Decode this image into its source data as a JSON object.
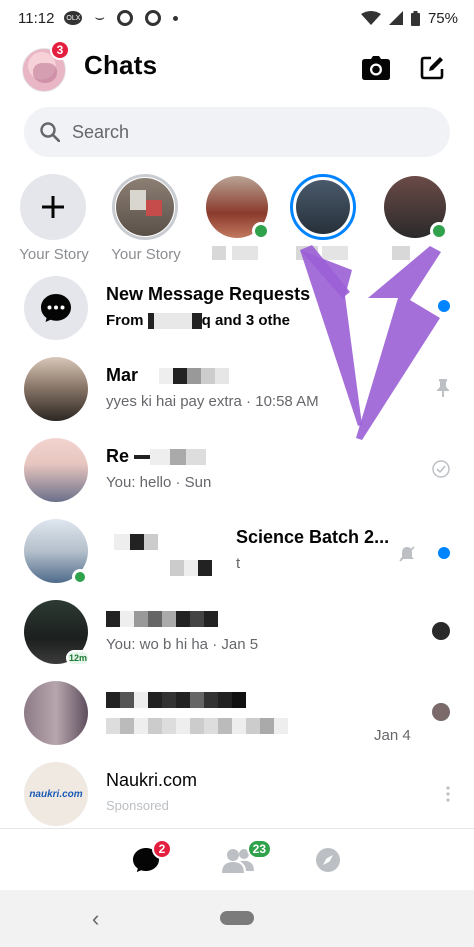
{
  "status_bar": {
    "time": "11:12",
    "battery": "75%",
    "left_icon_oval": "OLX"
  },
  "header": {
    "title": "Chats",
    "avatar_badge": "3"
  },
  "search": {
    "placeholder": "Search"
  },
  "stories": [
    {
      "label": "Your Story",
      "type": "add"
    },
    {
      "label": "Your Story",
      "type": "own"
    }
  ],
  "chats": [
    {
      "name": "New Message Requests",
      "subtitle_start": "From ",
      "subtitle_end": "q and 3 othe"
    },
    {
      "name": "Mar",
      "subtitle": "yyes ki hai pay extra · 10:58 AM"
    },
    {
      "name": "Re",
      "subtitle": "You: hello · Sun"
    },
    {
      "name": "Science Batch 2...",
      "subtitle": "t"
    },
    {
      "name": "",
      "subtitle": "You: wo b hi ha · Jan 5",
      "avatar_badge": "12m"
    },
    {
      "name": "",
      "subtitle": "",
      "time": "Jan 4"
    },
    {
      "name": "Naukri.com",
      "subtitle": "Sponsored",
      "avatar_text": "naukri.com"
    }
  ],
  "bottom_nav": {
    "chats_badge": "2",
    "people_badge": "23"
  },
  "colors": {
    "accent": "#0084ff",
    "online": "#31a24c",
    "badge_red": "#e41e3f",
    "annotation_arrow": "#9b5fd6"
  }
}
